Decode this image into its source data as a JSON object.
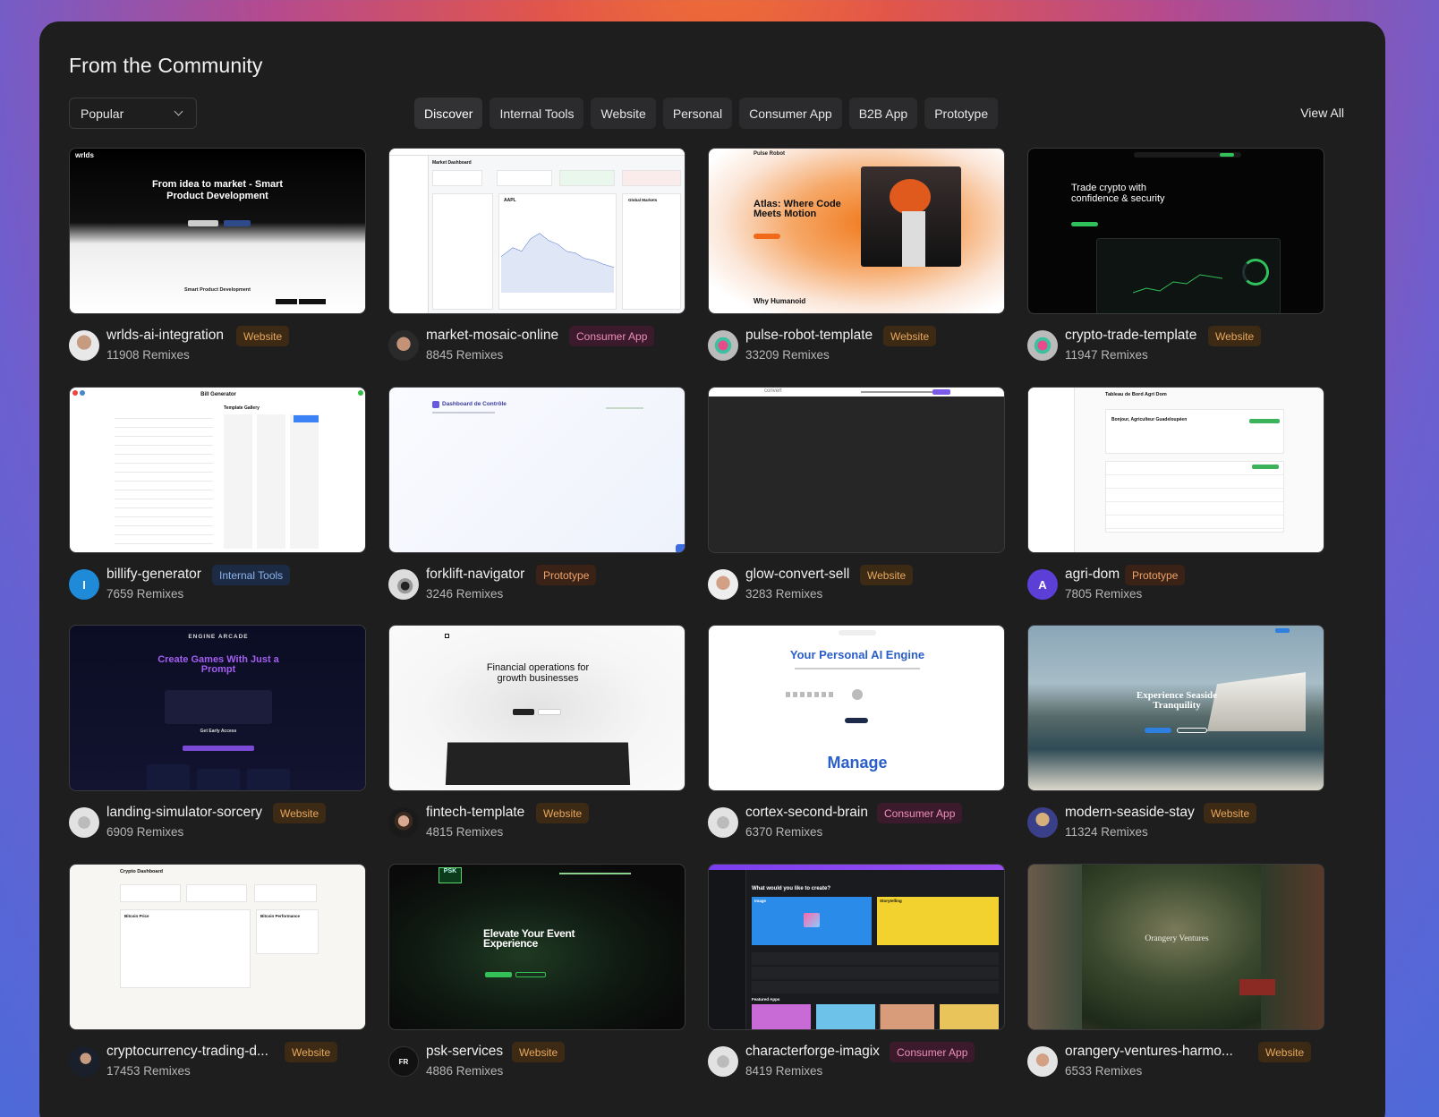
{
  "header": {
    "title": "From the Community",
    "sort_value": "Popular",
    "view_all": "View All"
  },
  "tabs": [
    "Discover",
    "Internal Tools",
    "Website",
    "Personal",
    "Consumer App",
    "B2B App",
    "Prototype"
  ],
  "active_tab": "Discover",
  "projects": [
    {
      "name": "wrlds-ai-integration",
      "badge": "Website",
      "remixes": "11908 Remixes",
      "thumb": {
        "headline": "From idea to market - Smart Product Development",
        "footer": "Smart Product Development"
      }
    },
    {
      "name": "market-mosaic-online",
      "badge": "Consumer App",
      "remixes": "8845 Remixes",
      "thumb": {
        "headline": "Market Dashboard",
        "ticker": "AAPL",
        "panel": "Global Markets"
      }
    },
    {
      "name": "pulse-robot-template",
      "badge": "Website",
      "remixes": "33209 Remixes",
      "thumb": {
        "brand": "Pulse Robot",
        "headline": "Atlas: Where Code Meets Motion",
        "footer": "Why Humanoid"
      }
    },
    {
      "name": "crypto-trade-template",
      "badge": "Website",
      "remixes": "11947 Remixes",
      "thumb": {
        "headline": "Trade crypto with confidence & security"
      }
    },
    {
      "name": "billify-generator",
      "badge": "Internal Tools",
      "remixes": "7659 Remixes",
      "thumb": {
        "headline": "Bill Generator",
        "gallery": "Template Gallery"
      }
    },
    {
      "name": "forklift-navigator",
      "badge": "Prototype",
      "remixes": "3246 Remixes",
      "thumb": {
        "headline": "Dashboard de Contrôle"
      }
    },
    {
      "name": "glow-convert-sell",
      "badge": "Website",
      "remixes": "3283 Remixes",
      "thumb": {
        "brand": "convert"
      }
    },
    {
      "name": "agri-dom",
      "badge": "Prototype",
      "remixes": "7805 Remixes",
      "thumb": {
        "headline": "Tableau de Bord Agri Dom",
        "greeting": "Bonjour, Agriculteur Guadeloupéen"
      }
    },
    {
      "name": "landing-simulator-sorcery",
      "badge": "Website",
      "remixes": "6909 Remixes",
      "thumb": {
        "brand": "ENGINE ARCADE",
        "headline": "Create Games With Just a Prompt",
        "cta": "Get Early Access"
      }
    },
    {
      "name": "fintech-template",
      "badge": "Website",
      "remixes": "4815 Remixes",
      "thumb": {
        "headline": "Financial operations for growth businesses"
      }
    },
    {
      "name": "cortex-second-brain",
      "badge": "Consumer App",
      "remixes": "6370 Remixes",
      "thumb": {
        "headline": "Your Personal AI Engine",
        "footer": "Manage"
      }
    },
    {
      "name": "modern-seaside-stay",
      "badge": "Website",
      "remixes": "11324 Remixes",
      "thumb": {
        "headline": "Experience Seaside Tranquility"
      }
    },
    {
      "name": "cryptocurrency-trading-d...",
      "badge": "Website",
      "remixes": "17453 Remixes",
      "thumb": {
        "headline": "Crypto Dashboard",
        "card1": "Bitcoin Price",
        "card2": "Bitcoin Performance"
      }
    },
    {
      "name": "psk-services",
      "badge": "Website",
      "remixes": "4886 Remixes",
      "thumb": {
        "headline": "Elevate Your Event Experience",
        "logo": "PSK"
      }
    },
    {
      "name": "characterforge-imagix",
      "badge": "Consumer App",
      "remixes": "8419 Remixes",
      "thumb": {
        "headline": "What would you like to create?",
        "a": "Image",
        "b": "Storytelling",
        "c": "Featured Apps"
      }
    },
    {
      "name": "orangery-ventures-harmo...",
      "badge": "Website",
      "remixes": "6533 Remixes",
      "thumb": {
        "headline": "Orangery Ventures"
      }
    }
  ],
  "colors": {
    "panel": "#1e1e1f",
    "website_badge": "#e9a85c",
    "consumer_badge": "#ef8fb9",
    "internal_badge": "#8db4ef",
    "prototype_badge": "#f0a36a"
  }
}
